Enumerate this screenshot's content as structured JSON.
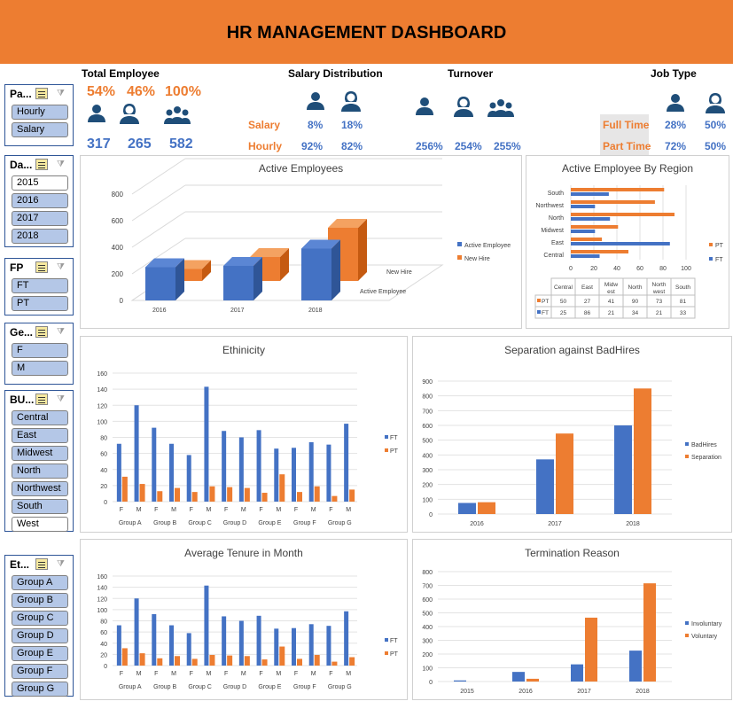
{
  "title": "HR MANAGEMENT DASHBOARD",
  "kpi": {
    "total_employee": {
      "title": "Total Employee",
      "pct": [
        "54%",
        "46%",
        "100%"
      ],
      "nums": [
        "317",
        "265",
        "582"
      ]
    },
    "salary": {
      "title": "Salary Distribution",
      "rows": [
        {
          "label": "Salary",
          "v1": "8%",
          "v2": "18%"
        },
        {
          "label": "Hourly",
          "v1": "92%",
          "v2": "82%"
        }
      ]
    },
    "turnover": {
      "title": "Turnover",
      "vals": [
        "256%",
        "254%",
        "255%"
      ]
    },
    "job": {
      "title": "Job Type",
      "rows": [
        {
          "label": "Full Time",
          "v1": "28%",
          "v2": "50%"
        },
        {
          "label": "Part Time",
          "v1": "72%",
          "v2": "50%"
        }
      ]
    }
  },
  "slicers": [
    {
      "title": "Pa...",
      "items": [
        "Hourly",
        "Salary"
      ]
    },
    {
      "title": "Da...",
      "items": [
        "2015",
        "2016",
        "2017",
        "2018"
      ],
      "off": [
        0
      ]
    },
    {
      "title": "FP",
      "items": [
        "FT",
        "PT"
      ]
    },
    {
      "title": "Ge...",
      "items": [
        "F",
        "M"
      ]
    },
    {
      "title": "BU...",
      "items": [
        "Central",
        "East",
        "Midwest",
        "North",
        "Northwest",
        "South",
        "West"
      ],
      "off": [
        6
      ]
    },
    {
      "title": "Et...",
      "items": [
        "Group A",
        "Group B",
        "Group C",
        "Group D",
        "Group E",
        "Group F",
        "Group G"
      ]
    }
  ],
  "colors": {
    "blue": "#4472C4",
    "orange": "#ED7D31",
    "header": "#ED7D31"
  },
  "chart_data": [
    {
      "id": "active",
      "type": "bar",
      "title": "Active Employees",
      "categories": [
        "2016",
        "2017",
        "2018"
      ],
      "series": [
        {
          "name": "Active Employee",
          "values": [
            250,
            260,
            390
          ]
        },
        {
          "name": "New Hire",
          "values": [
            90,
            180,
            400
          ]
        }
      ],
      "yticks": [
        "0",
        "200",
        "400",
        "600",
        "800"
      ],
      "ylim": [
        0,
        800
      ],
      "depth_labels": [
        "New Hire",
        "Active Employee"
      ]
    },
    {
      "id": "region",
      "type": "bar",
      "title": "Active Employee By Region",
      "categories": [
        "Central",
        "East",
        "Midwest",
        "North",
        "Northwest",
        "South"
      ],
      "category_labels": [
        "Central",
        "East",
        "Midw\nest",
        "North",
        "North\nwest",
        "South"
      ],
      "series": [
        {
          "name": "PT",
          "values": [
            50,
            27,
            41,
            90,
            73,
            81
          ]
        },
        {
          "name": "FT",
          "values": [
            25,
            86,
            21,
            34,
            21,
            33
          ]
        }
      ],
      "xticks": [
        "0",
        "20",
        "40",
        "60",
        "80",
        "100"
      ],
      "xlim": [
        0,
        100
      ]
    },
    {
      "id": "ethnicity",
      "type": "bar",
      "title": "Ethinicity",
      "groups": [
        "Group A",
        "Group B",
        "Group C",
        "Group D",
        "Group E",
        "Group F",
        "Group G"
      ],
      "sub": [
        "F",
        "M"
      ],
      "series": [
        {
          "name": "FT",
          "values": [
            72,
            120,
            92,
            72,
            58,
            143,
            88,
            80,
            89,
            66,
            67,
            74,
            71,
            97
          ]
        },
        {
          "name": "PT",
          "values": [
            31,
            22,
            13,
            17,
            12,
            19,
            18,
            17,
            11,
            34,
            12,
            19,
            7,
            15
          ]
        }
      ],
      "yticks": [
        "0",
        "20",
        "40",
        "60",
        "80",
        "100",
        "120",
        "140",
        "160"
      ],
      "ylim": [
        0,
        160
      ]
    },
    {
      "id": "separation",
      "type": "bar",
      "title": "Separation against BadHires",
      "categories": [
        "2016",
        "2017",
        "2018"
      ],
      "series": [
        {
          "name": "BadHires",
          "values": [
            75,
            370,
            600
          ]
        },
        {
          "name": "Separation",
          "values": [
            80,
            545,
            850
          ]
        }
      ],
      "yticks": [
        "0",
        "100",
        "200",
        "300",
        "400",
        "500",
        "600",
        "700",
        "800",
        "900"
      ],
      "ylim": [
        0,
        900
      ]
    },
    {
      "id": "tenure",
      "type": "bar",
      "title": "Average Tenure in Month",
      "groups": [
        "Group A",
        "Group B",
        "Group C",
        "Group D",
        "Group E",
        "Group F",
        "Group G"
      ],
      "sub": [
        "F",
        "M"
      ],
      "series": [
        {
          "name": "FT",
          "values": [
            72,
            120,
            92,
            72,
            58,
            143,
            88,
            80,
            89,
            66,
            67,
            74,
            71,
            97
          ]
        },
        {
          "name": "PT",
          "values": [
            31,
            22,
            13,
            17,
            12,
            19,
            18,
            17,
            11,
            34,
            12,
            19,
            7,
            15
          ]
        }
      ],
      "yticks": [
        "0",
        "20",
        "40",
        "60",
        "80",
        "100",
        "120",
        "140",
        "160"
      ],
      "ylim": [
        0,
        160
      ]
    },
    {
      "id": "termination",
      "type": "bar",
      "title": "Termination Reason",
      "categories": [
        "2015",
        "2016",
        "2017",
        "2018"
      ],
      "series": [
        {
          "name": "Involuntary",
          "values": [
            8,
            70,
            125,
            225
          ]
        },
        {
          "name": "Voluntary",
          "values": [
            0,
            20,
            465,
            715
          ]
        }
      ],
      "yticks": [
        "0",
        "100",
        "200",
        "300",
        "400",
        "500",
        "600",
        "700",
        "800"
      ],
      "ylim": [
        0,
        800
      ]
    }
  ]
}
